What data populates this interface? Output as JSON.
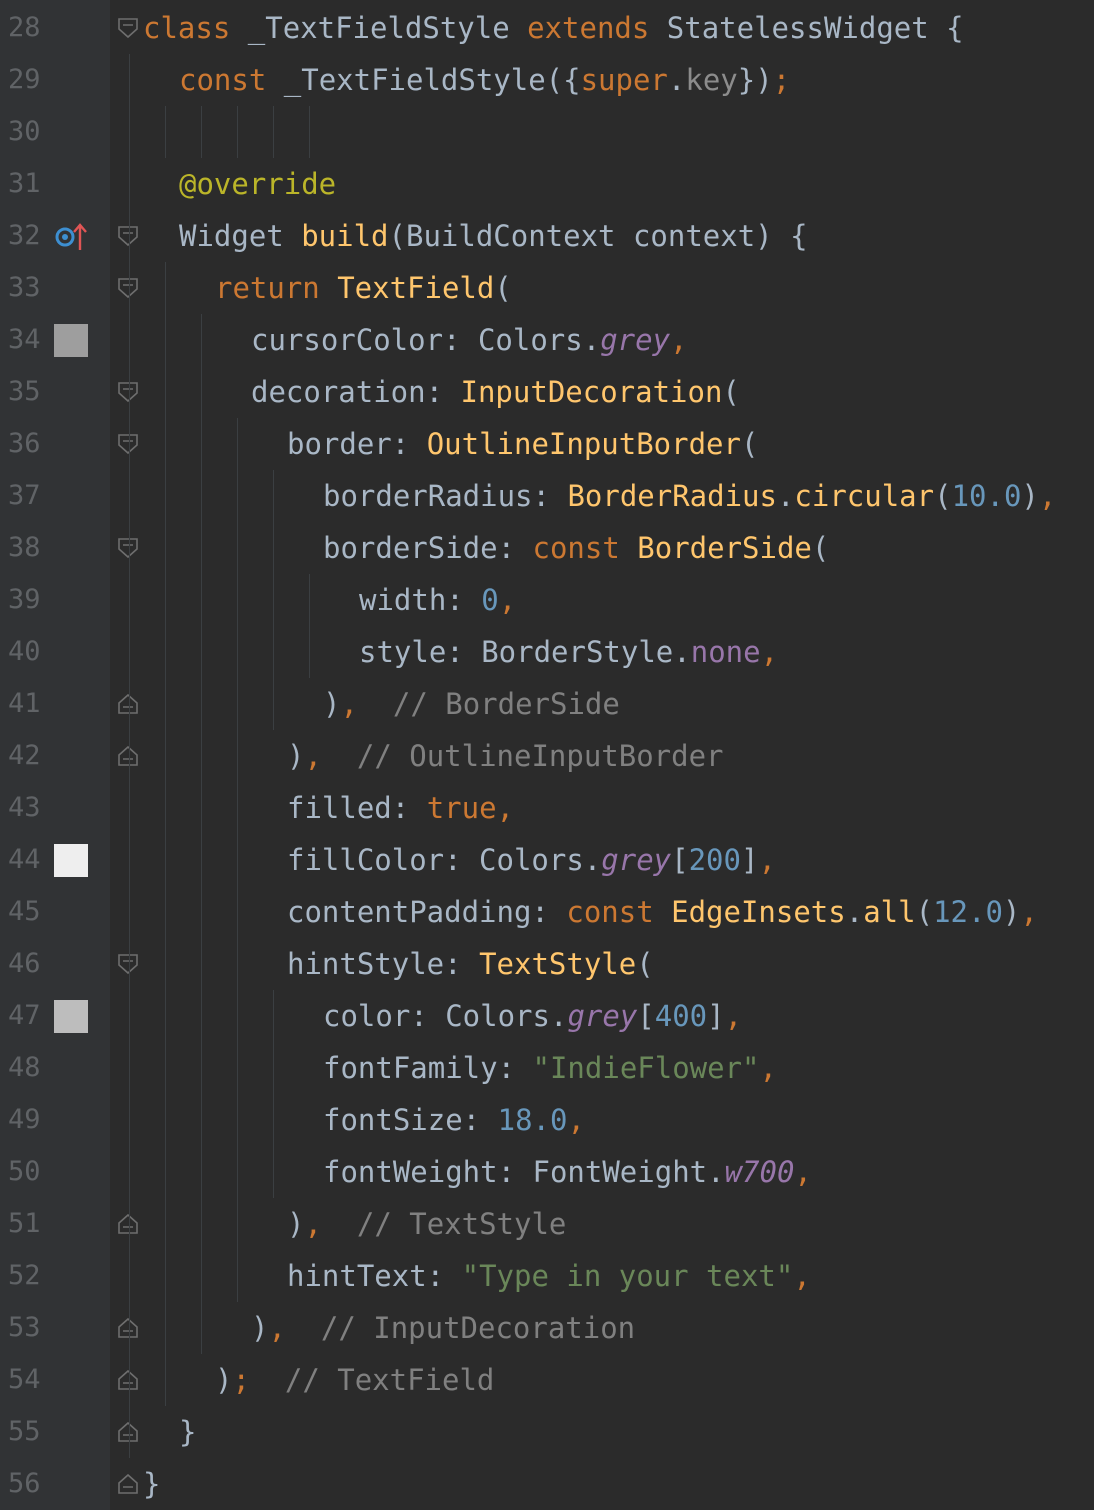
{
  "colors": {
    "background": "#2b2b2b",
    "keyword": "#cc7832",
    "function": "#ffc66d",
    "number": "#6897bb",
    "string": "#6a8759",
    "comment": "#808080",
    "property": "#9876aa",
    "annotation": "#bbb529",
    "line_number": "#606366"
  },
  "lines": [
    {
      "num": "28",
      "indent": 0,
      "fold": "start",
      "tokens": [
        [
          "k",
          "class"
        ],
        [
          "p",
          " _TextFieldStyle "
        ],
        [
          "k",
          "extends"
        ],
        [
          "p",
          " StatelessWidget {"
        ]
      ]
    },
    {
      "num": "29",
      "indent": 1,
      "tokens": [
        [
          "k",
          "const"
        ],
        [
          "p",
          " _TextFieldStyle({"
        ],
        [
          "k",
          "super"
        ],
        [
          "p",
          "."
        ],
        [
          "sk",
          "key"
        ],
        [
          "p",
          "})"
        ],
        [
          "k",
          ";"
        ]
      ]
    },
    {
      "num": "30",
      "indent": 1,
      "tokens": []
    },
    {
      "num": "31",
      "indent": 1,
      "tokens": [
        [
          "an",
          "@override"
        ]
      ]
    },
    {
      "num": "32",
      "indent": 1,
      "fold": "start",
      "marker": "override-icon",
      "tokens": [
        [
          "p",
          "Widget "
        ],
        [
          "fn",
          "build"
        ],
        [
          "p",
          "(BuildContext context) {"
        ]
      ]
    },
    {
      "num": "33",
      "indent": 2,
      "fold": "start",
      "tokens": [
        [
          "k",
          "return "
        ],
        [
          "fn",
          "TextField"
        ],
        [
          "p",
          "("
        ]
      ]
    },
    {
      "num": "34",
      "indent": 3,
      "marker": "swatch",
      "swatch": "#9e9e9e",
      "tokens": [
        [
          "p",
          "cursorColor: Colors."
        ],
        [
          "it",
          "grey"
        ],
        [
          "k",
          ","
        ]
      ]
    },
    {
      "num": "35",
      "indent": 3,
      "fold": "start",
      "tokens": [
        [
          "p",
          "decoration: "
        ],
        [
          "fn",
          "InputDecoration"
        ],
        [
          "p",
          "("
        ]
      ]
    },
    {
      "num": "36",
      "indent": 4,
      "fold": "start",
      "tokens": [
        [
          "p",
          "border: "
        ],
        [
          "fn",
          "OutlineInputBorder"
        ],
        [
          "p",
          "("
        ]
      ]
    },
    {
      "num": "37",
      "indent": 5,
      "tokens": [
        [
          "p",
          "borderRadius: "
        ],
        [
          "fn",
          "BorderRadius"
        ],
        [
          "p",
          "."
        ],
        [
          "fn",
          "circular"
        ],
        [
          "p",
          "("
        ],
        [
          "n",
          "10.0"
        ],
        [
          "p",
          ")"
        ],
        [
          "k",
          ","
        ]
      ]
    },
    {
      "num": "38",
      "indent": 5,
      "fold": "start",
      "tokens": [
        [
          "p",
          "borderSide: "
        ],
        [
          "k",
          "const "
        ],
        [
          "fn",
          "BorderSide"
        ],
        [
          "p",
          "("
        ]
      ]
    },
    {
      "num": "39",
      "indent": 6,
      "tokens": [
        [
          "p",
          "width: "
        ],
        [
          "n",
          "0"
        ],
        [
          "k",
          ","
        ]
      ]
    },
    {
      "num": "40",
      "indent": 6,
      "tokens": [
        [
          "p",
          "style: BorderStyle."
        ],
        [
          "pv",
          "none"
        ],
        [
          "k",
          ","
        ]
      ]
    },
    {
      "num": "41",
      "indent": 5,
      "fold": "end",
      "tokens": [
        [
          "p",
          ")"
        ],
        [
          "k",
          ","
        ],
        [
          "c",
          "  // BorderSide"
        ]
      ]
    },
    {
      "num": "42",
      "indent": 4,
      "fold": "end",
      "tokens": [
        [
          "p",
          ")"
        ],
        [
          "k",
          ","
        ],
        [
          "c",
          "  // OutlineInputBorder"
        ]
      ]
    },
    {
      "num": "43",
      "indent": 4,
      "tokens": [
        [
          "p",
          "filled: "
        ],
        [
          "k",
          "true,"
        ]
      ]
    },
    {
      "num": "44",
      "indent": 4,
      "marker": "swatch",
      "swatch": "#eeeeee",
      "tokens": [
        [
          "p",
          "fillColor: Colors."
        ],
        [
          "it",
          "grey"
        ],
        [
          "p",
          "["
        ],
        [
          "n",
          "200"
        ],
        [
          "p",
          "]"
        ],
        [
          "k",
          ","
        ]
      ]
    },
    {
      "num": "45",
      "indent": 4,
      "tokens": [
        [
          "p",
          "contentPadding: "
        ],
        [
          "k",
          "const "
        ],
        [
          "fn",
          "EdgeInsets"
        ],
        [
          "p",
          "."
        ],
        [
          "fn",
          "all"
        ],
        [
          "p",
          "("
        ],
        [
          "n",
          "12.0"
        ],
        [
          "p",
          ")"
        ],
        [
          "k",
          ","
        ]
      ]
    },
    {
      "num": "46",
      "indent": 4,
      "fold": "start",
      "tokens": [
        [
          "p",
          "hintStyle: "
        ],
        [
          "fn",
          "TextStyle"
        ],
        [
          "p",
          "("
        ]
      ]
    },
    {
      "num": "47",
      "indent": 5,
      "marker": "swatch",
      "swatch": "#bdbdbd",
      "tokens": [
        [
          "p",
          "color: Colors."
        ],
        [
          "it",
          "grey"
        ],
        [
          "p",
          "["
        ],
        [
          "n",
          "400"
        ],
        [
          "p",
          "]"
        ],
        [
          "k",
          ","
        ]
      ]
    },
    {
      "num": "48",
      "indent": 5,
      "tokens": [
        [
          "p",
          "fontFamily: "
        ],
        [
          "s",
          "\"IndieFlower\""
        ],
        [
          "k",
          ","
        ]
      ]
    },
    {
      "num": "49",
      "indent": 5,
      "tokens": [
        [
          "p",
          "fontSize: "
        ],
        [
          "n",
          "18.0"
        ],
        [
          "k",
          ","
        ]
      ]
    },
    {
      "num": "50",
      "indent": 5,
      "tokens": [
        [
          "p",
          "fontWeight: FontWeight."
        ],
        [
          "it",
          "w700"
        ],
        [
          "k",
          ","
        ]
      ]
    },
    {
      "num": "51",
      "indent": 4,
      "fold": "end",
      "tokens": [
        [
          "p",
          ")"
        ],
        [
          "k",
          ","
        ],
        [
          "c",
          "  // TextStyle"
        ]
      ]
    },
    {
      "num": "52",
      "indent": 4,
      "tokens": [
        [
          "p",
          "hintText: "
        ],
        [
          "s",
          "\"Type in your text\""
        ],
        [
          "k",
          ","
        ]
      ]
    },
    {
      "num": "53",
      "indent": 3,
      "fold": "end",
      "tokens": [
        [
          "p",
          ")"
        ],
        [
          "k",
          ","
        ],
        [
          "c",
          "  // InputDecoration"
        ]
      ]
    },
    {
      "num": "54",
      "indent": 2,
      "fold": "end",
      "tokens": [
        [
          "p",
          ")"
        ],
        [
          "k",
          ";"
        ],
        [
          "c",
          "  // TextField"
        ]
      ]
    },
    {
      "num": "55",
      "indent": 1,
      "fold": "end",
      "tokens": [
        [
          "p",
          "}"
        ]
      ]
    },
    {
      "num": "56",
      "indent": 0,
      "fold": "end",
      "tokens": [
        [
          "p",
          "}"
        ]
      ]
    }
  ]
}
